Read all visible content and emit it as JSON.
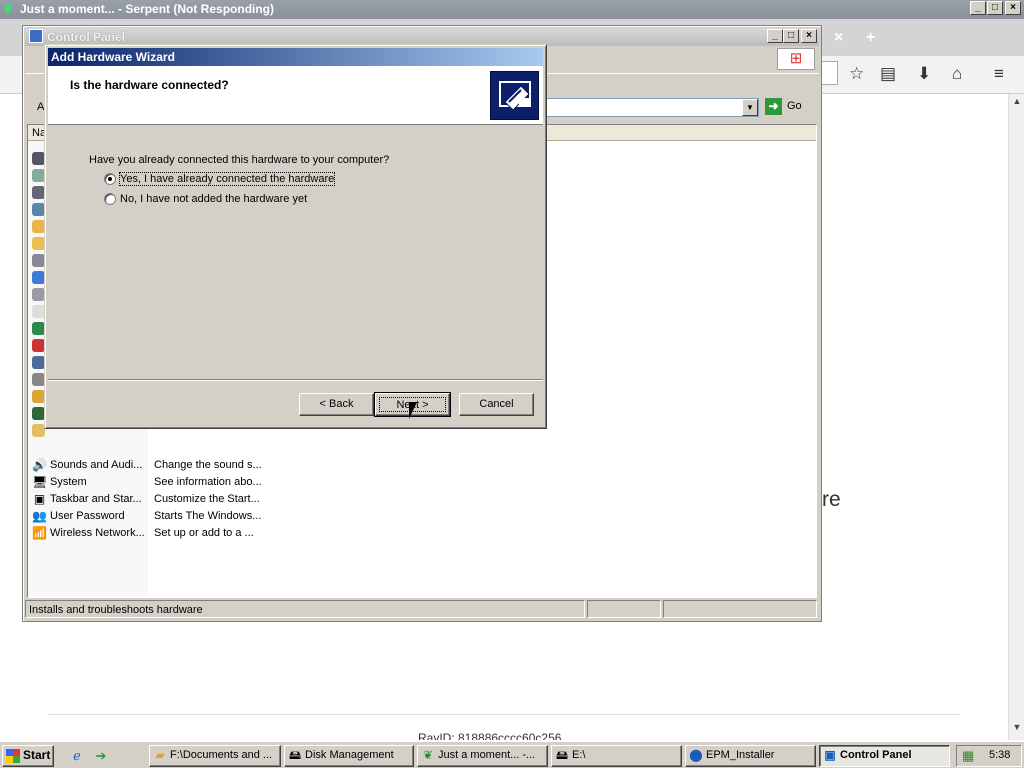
{
  "browser": {
    "title": "Just a moment... - Serpent (Not Responding)",
    "controls": [
      "_",
      "□",
      "×"
    ],
    "tab_close": "×",
    "new_tab": "+",
    "page_text_fragment": "re",
    "page_devid_fragment": "RayID: 818886cccc60c256"
  },
  "control_panel": {
    "title": "Control Panel",
    "controls": [
      "_",
      "□",
      "×"
    ],
    "address_fragment": "A",
    "go_label": "Go",
    "list_header_fragment": "Na",
    "rows": [
      {
        "name": "Sounds and Audi...",
        "desc": "Change the sound s...",
        "icon": "speaker-icon"
      },
      {
        "name": "System",
        "desc": "See information abo...",
        "icon": "computer-icon"
      },
      {
        "name": "Taskbar and Star...",
        "desc": "Customize the Start...",
        "icon": "taskbar-icon"
      },
      {
        "name": "User Password",
        "desc": "Starts The Windows...",
        "icon": "users-icon"
      },
      {
        "name": "Wireless Network...",
        "desc": "Set up or add to a ...",
        "icon": "wireless-icon"
      }
    ],
    "status_text": "Installs and troubleshoots hardware"
  },
  "wizard": {
    "title": "Add Hardware Wizard",
    "question": "Is the hardware connected?",
    "prompt": "Have you already connected this hardware to your computer?",
    "options": [
      {
        "label": "Yes, I have already connected the hardware",
        "selected": true
      },
      {
        "label": "No, I have not added the hardware yet",
        "selected": false
      }
    ],
    "buttons": {
      "back": "< Back",
      "next": "Next >",
      "cancel": "Cancel"
    }
  },
  "taskbar": {
    "start_label": "Start",
    "items": [
      {
        "label": "F:\\Documents and ...",
        "icon": "folder-icon",
        "active": false
      },
      {
        "label": "Disk Management",
        "icon": "disk-management-icon",
        "active": false
      },
      {
        "label": "Just a moment... -...",
        "icon": "browser-icon",
        "active": false
      },
      {
        "label": "E:\\",
        "icon": "drive-icon",
        "active": false
      },
      {
        "label": "EPM_Installer",
        "icon": "installer-icon",
        "active": false
      },
      {
        "label": "Control Panel",
        "icon": "control-panel-icon",
        "active": true
      }
    ],
    "clock": "5:38"
  }
}
